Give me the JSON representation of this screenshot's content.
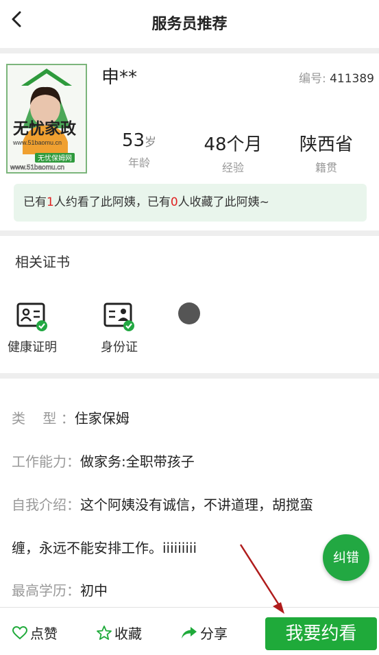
{
  "header": {
    "title": "服务员推荐"
  },
  "profile": {
    "name": "申**",
    "id_label": "编号:",
    "id_value": "411389",
    "photo_texts": {
      "brand": "无忧家政",
      "url": "www.51baomu.cn",
      "badge": "无忧保姆网"
    },
    "stats": [
      {
        "value": "53",
        "unit": "岁",
        "label": "年龄"
      },
      {
        "value": "48个月",
        "unit": "",
        "label": "经验"
      },
      {
        "value": "陕西省",
        "unit": "",
        "label": "籍贯"
      }
    ],
    "notice": {
      "prefix": "已有",
      "views": "1",
      "middle": "人约看了此阿姨，已有",
      "favorites": "0",
      "suffix": "人收藏了此阿姨~"
    }
  },
  "certificates": {
    "title": "相关证书",
    "items": [
      {
        "label": "健康证明",
        "icon": "health-certificate-icon"
      },
      {
        "label": "身份证",
        "icon": "id-card-icon"
      }
    ]
  },
  "details": {
    "type": {
      "key": "类    型 ：",
      "value": "住家保姆"
    },
    "ability": {
      "key": "工作能力：",
      "value": "做家务:全职带孩子"
    },
    "intro": {
      "key": "自我介绍：",
      "value_line1": "这个阿姨没有诚信，不讲道理，胡搅蛮",
      "value_line2": "缠，永远不能安排工作。iiiiiiiii"
    },
    "education": {
      "key": "最高学历：",
      "value": "初中"
    }
  },
  "fab": {
    "label": "纠错"
  },
  "bottom_bar": {
    "like": "点赞",
    "favorite": "收藏",
    "share": "分享",
    "book": "我要约看"
  },
  "colors": {
    "accent": "#1faa3a",
    "highlight": "#e02020",
    "notice_bg": "#e9f5ec",
    "annotation_arrow": "#b01c1c"
  }
}
